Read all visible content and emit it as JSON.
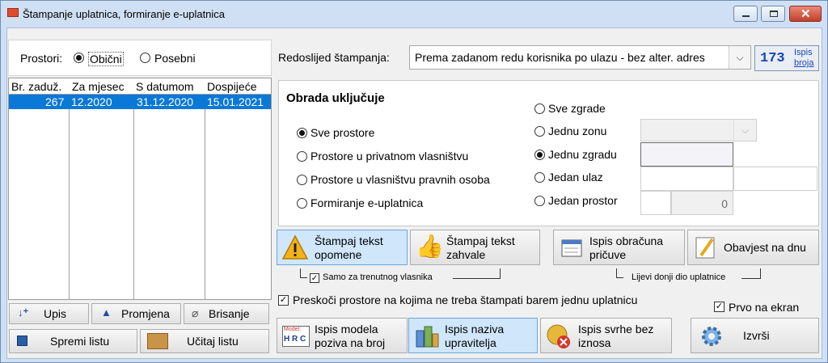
{
  "window": {
    "title": "Štampanje uplatnica, formiranje e-uplatnica"
  },
  "prostori": {
    "label": "Prostori:",
    "options": [
      "Obični",
      "Posebni"
    ],
    "selected": "Obični"
  },
  "table": {
    "headers": [
      "Br. zaduž.",
      "Za mjesec",
      "S datumom",
      "Dospijeće"
    ],
    "rows": [
      {
        "br": "267",
        "mjesec": "12.2020",
        "datum": "31.12.2020",
        "dospijece": "15.01.2021"
      }
    ]
  },
  "list_buttons": {
    "upis": "Upis",
    "promjena": "Promjena",
    "brisanje": "Brisanje",
    "spremi": "Spremi listu",
    "ucitaj": "Učitaj listu"
  },
  "redoslijed": {
    "label": "Redoslijed štampanja:",
    "value": "Prema zadanom redu korisnika po ulazu - bez alter. adres"
  },
  "ispis_broja": {
    "number": "173",
    "label1": "Ispis",
    "label2": "broja"
  },
  "obrada": {
    "title": "Obrada uključuje",
    "left_options": [
      "Sve prostore",
      "Prostore u privatnom vlasništvu",
      "Prostore u vlasništvu pravnih osoba",
      "Formiranje e-uplatnica"
    ],
    "left_selected": "Sve prostore",
    "right_options": [
      "Sve zgrade",
      "Jednu zonu",
      "Jednu zgradu",
      "Jedan ulaz",
      "Jedan prostor"
    ],
    "right_selected": "Jednu zgradu",
    "prostor_value": "0"
  },
  "actions": {
    "opomene_line1": "Štampaj tekst",
    "opomene_line2": "opomene",
    "zahvale_line1": "Štampaj tekst",
    "zahvale_line2": "zahvale",
    "obracuna_line1": "Ispis obračuna",
    "obracuna_line2": "pričuve",
    "obavijest": "Obavjest na dnu"
  },
  "checks": {
    "samo_vlasnika": "Samo za trenutnog vlasnika",
    "lijevi_donji": "Lijevi donji dio uplatnice",
    "preskoci": "Preskoči prostore na kojima ne treba štampati barem jednu uplatnicu",
    "prvo_na_ekran": "Prvo na ekran"
  },
  "bottom_buttons": {
    "model_line1": "Ispis modela",
    "model_line2": "poziva na broj",
    "model_icon_text": "Model:",
    "model_icon_letters": "H R C",
    "naziva_line1": "Ispis naziva",
    "naziva_line2": "upravitelja",
    "svrhe_line1": "Ispis svrhe bez",
    "svrhe_line2": "iznosa",
    "izvrsi": "Izvrši"
  },
  "colors": {
    "selection": "#0a78d7",
    "highlight_button": "#cfe6fb",
    "title_bg": "#cfe0f4"
  }
}
